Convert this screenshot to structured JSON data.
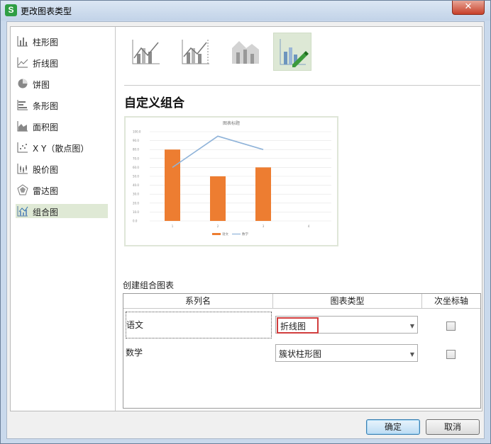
{
  "window": {
    "title": "更改图表类型",
    "app_icon": "S",
    "close_glyph": "✕"
  },
  "sidebar": {
    "items": [
      {
        "label": "柱形图",
        "icon": "column-chart-icon",
        "selected": false
      },
      {
        "label": "折线图",
        "icon": "line-chart-icon",
        "selected": false
      },
      {
        "label": "饼图",
        "icon": "pie-chart-icon",
        "selected": false
      },
      {
        "label": "条形图",
        "icon": "bar-chart-icon",
        "selected": false
      },
      {
        "label": "面积图",
        "icon": "area-chart-icon",
        "selected": false
      },
      {
        "label": "X Y（散点图）",
        "icon": "scatter-chart-icon",
        "selected": false
      },
      {
        "label": "股价图",
        "icon": "stock-chart-icon",
        "selected": false
      },
      {
        "label": "雷达图",
        "icon": "radar-chart-icon",
        "selected": false
      },
      {
        "label": "组合图",
        "icon": "combo-chart-icon",
        "selected": true
      }
    ]
  },
  "subtypes": [
    {
      "icon": "clustered-column-line-icon",
      "selected": false
    },
    {
      "icon": "clustered-column-line-secondary-axis-icon",
      "selected": false
    },
    {
      "icon": "stacked-area-clustered-column-icon",
      "selected": false
    },
    {
      "icon": "custom-combination-icon",
      "selected": true
    }
  ],
  "heading": "自定义组合",
  "preview": {
    "chart_data": {
      "type": "bar",
      "title": "图表标题",
      "categories": [
        "1",
        "2",
        "3",
        "4"
      ],
      "ylim": [
        0,
        100
      ],
      "grid": true,
      "legend_position": "bottom",
      "series": [
        {
          "name": "语文",
          "kind": "column",
          "color": "#ed7d31",
          "values": [
            80,
            50,
            60,
            null
          ]
        },
        {
          "name": "数学",
          "kind": "line",
          "color": "#8fb3d9",
          "values": [
            60,
            95,
            80,
            null
          ]
        }
      ]
    }
  },
  "combo": {
    "section_label": "创建组合图表",
    "headers": {
      "series_name": "系列名",
      "chart_type": "图表类型",
      "secondary_axis": "次坐标轴"
    },
    "rows": [
      {
        "name": "语文",
        "chart_type": "折线图",
        "secondary_axis": false
      },
      {
        "name": "数学",
        "chart_type": "簇状柱形图",
        "secondary_axis": false
      }
    ]
  },
  "buttons": {
    "ok": "确定",
    "cancel": "取消"
  },
  "colors": {
    "accent_orange": "#ed7d31",
    "accent_blue": "#8fb3d9",
    "selection_green": "#dfe9d5",
    "highlight_red": "#d13d3d"
  }
}
